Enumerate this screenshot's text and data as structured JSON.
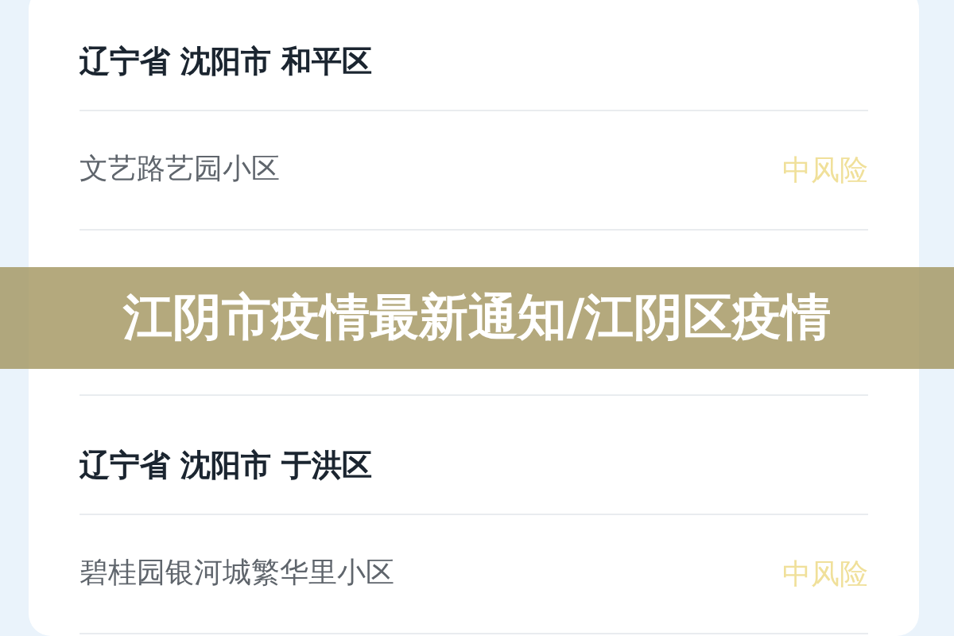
{
  "sections": [
    {
      "title": "辽宁省 沈阳市 和平区",
      "places": [
        {
          "name": "文艺路艺园小区",
          "risk": "中风险"
        }
      ]
    },
    {
      "title": "辽宁省 沈阳市 于洪区",
      "places": [
        {
          "name": "碧桂园银河城繁华里小区",
          "risk": "中风险"
        }
      ]
    }
  ],
  "banner": {
    "title": "江阴市疫情最新通知/江阴区疫情"
  }
}
